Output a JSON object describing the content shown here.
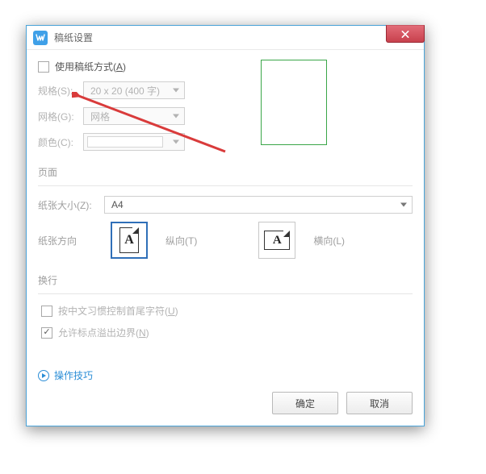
{
  "window": {
    "title": "稿纸设置"
  },
  "top": {
    "use_manuscript": "使用稿纸方式(",
    "use_manuscript_key": "A",
    "use_manuscript_close": ")",
    "spec_label": "规格(S):",
    "spec_value": "20 x 20 (400 字)",
    "grid_label": "网格(G):",
    "grid_value": "网格",
    "color_label": "颜色(C):"
  },
  "page": {
    "section": "页面",
    "size_label": "纸张大小(Z):",
    "size_value": "A4",
    "orient_label": "纸张方向",
    "portrait": "纵向(T)",
    "landscape": "横向(L)"
  },
  "wrap": {
    "section": "换行",
    "opt1": "按中文习惯控制首尾字符(",
    "opt1_key": "U",
    "opt1_close": ")",
    "opt2": "允许标点溢出边界(",
    "opt2_key": "N",
    "opt2_close": ")"
  },
  "tips": "操作技巧",
  "buttons": {
    "ok": "确定",
    "cancel": "取消"
  }
}
